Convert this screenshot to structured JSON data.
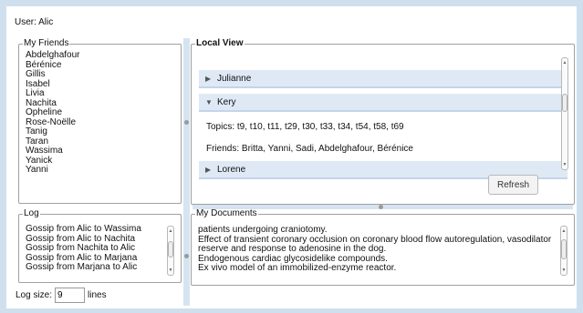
{
  "user": {
    "label": "User: Alic"
  },
  "friends": {
    "legend": "My Friends",
    "items": [
      "Abdelghafour",
      "Bérénice",
      "Gillis",
      "Isabel",
      "Livia",
      "Nachita",
      "Opheline",
      "Rose-Noëlle",
      "Tanig",
      "Taran",
      "Wassima",
      "Yanick",
      "Yanni"
    ]
  },
  "local_view": {
    "legend": "Local View",
    "sections": [
      {
        "name": "Julianne",
        "expanded": false
      },
      {
        "name": "Kery",
        "expanded": true
      },
      {
        "name": "Lorene",
        "expanded": false
      }
    ],
    "expanded_topics": "Topics:  t9, t10, t11, t29, t30, t33, t34, t54, t58, t69",
    "expanded_friends": "Friends: Britta, Yanni, Sadi, Abdelghafour, Bérénice",
    "refresh_label": "Refresh"
  },
  "log": {
    "legend": "Log",
    "items": [
      "Gossip from Alic to Wassima",
      "Gossip from Alic to Nachita",
      "Gossip from Nachita to Alic",
      "Gossip from Alic to Marjana",
      "Gossip from Marjana to Alic"
    ]
  },
  "documents": {
    "legend": "My Documents",
    "items": [
      "patients undergoing craniotomy.",
      "Effect of transient coronary occlusion on coronary blood flow autoregulation, vasodilator",
      "reserve and response to adenosine in the dog.",
      "Endogenous cardiac glycosidelike compounds.",
      "Ex vivo model of an immobilized-enzyme reactor."
    ]
  },
  "log_size": {
    "label": "Log size:",
    "value": "9",
    "unit": "lines"
  },
  "icons": [
    "triangle-right-icon",
    "triangle-down-icon",
    "splitter-grip-icon",
    "scroll-up-icon",
    "scroll-down-icon"
  ],
  "colors": {
    "frame": "#cfdfee",
    "accordion_header": "#dfe9f6",
    "splitter": "#d6e4f2"
  }
}
